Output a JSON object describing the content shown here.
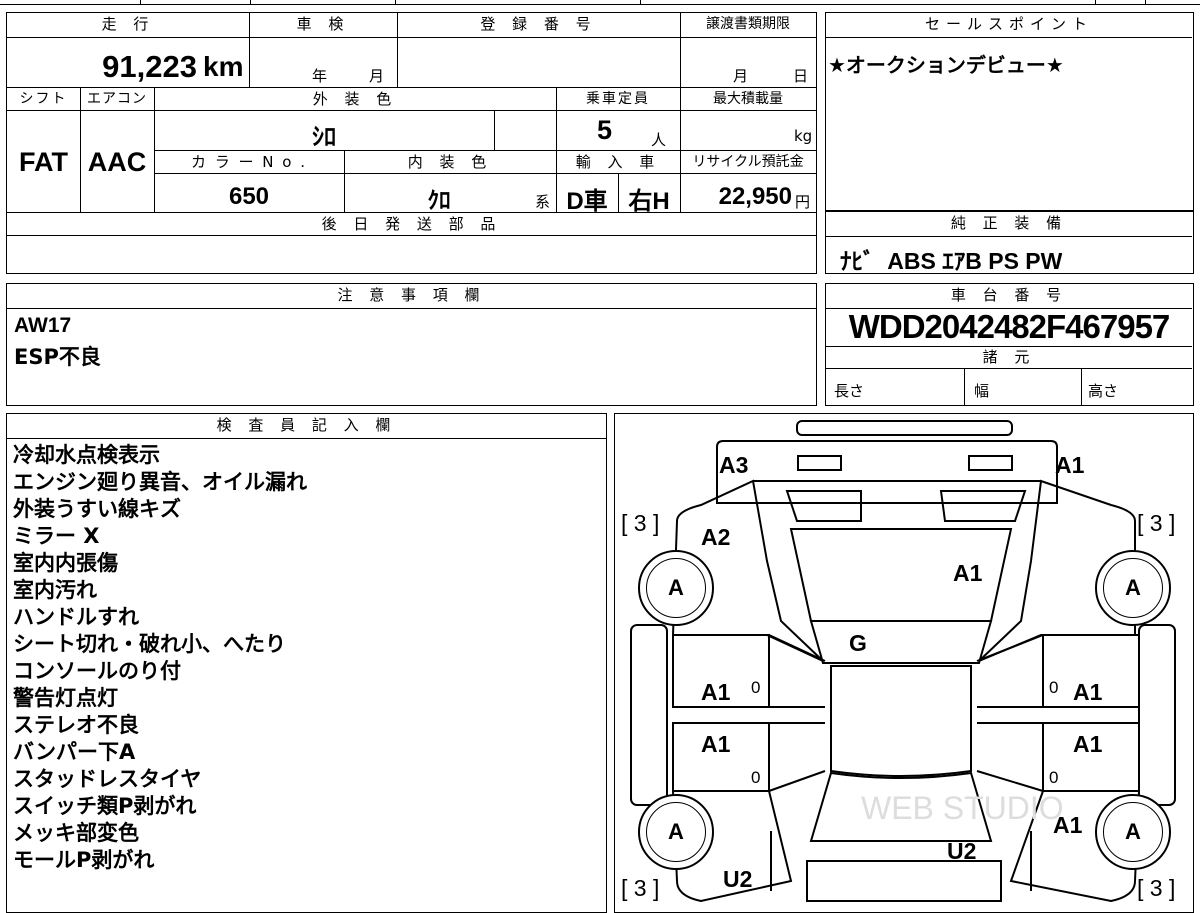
{
  "top_form": {
    "mileage_label": "走 行",
    "mileage": "91,223",
    "mileage_unit": "km",
    "inspection_label": "車 検",
    "year_unit": "年",
    "month_unit": "月",
    "registration_label": "登 録 番 号",
    "transfer_deadline_label": "譲渡書類期限",
    "deadline_month_unit": "月",
    "deadline_day_unit": "日",
    "shift_label": "シフト",
    "shift": "FAT",
    "aircon_label": "エアコン",
    "aircon": "AAC",
    "exterior_color_label": "外 装 色",
    "exterior_color": "ｼﾛ",
    "capacity_label": "乗車定員",
    "capacity": "5",
    "capacity_unit": "人",
    "max_load_label": "最大積載量",
    "max_load_unit": "kg",
    "color_no_label": "カ ラ ー N o .",
    "color_no": "650",
    "interior_color_label": "内 装 色",
    "interior_color": "ｸﾛ",
    "interior_color_suffix": "系",
    "import_label": "輸 入 車",
    "import_type": "D車",
    "steering": "右H",
    "recycle_label": "リサイクル預託金",
    "recycle_fee": "22,950",
    "recycle_unit": "円",
    "later_parts_label": "後 日 発 送 部 品"
  },
  "sales_points": {
    "label": "セールスポイント",
    "text": "★オークションデビュー★"
  },
  "genuine_equipment": {
    "label": "純 正 装 備",
    "text": "ﾅﾋﾞ  ABS ｴｱB PS PW"
  },
  "notes": {
    "label": "注 意 事 項 欄",
    "lines": [
      "AW17",
      "ESP不良"
    ]
  },
  "chassis": {
    "label": "車 台 番 号",
    "number": "WDD2042482F467957",
    "specs_label": "諸 元",
    "length_label": "長さ",
    "width_label": "幅",
    "height_label": "高さ"
  },
  "inspector": {
    "label": "検 査 員 記 入 欄",
    "lines": [
      "冷却水点検表示",
      "エンジン廻り異音、オイル漏れ",
      "外装うすい線キズ",
      "ミラー X",
      "室内内張傷",
      "室内汚れ",
      "ハンドルすれ",
      "シート切れ・破れ小、へたり",
      "コンソールのり付",
      "警告灯点灯",
      "ステレオ不良",
      "バンパー下A",
      "スタッドレスタイヤ",
      "スイッチ類P剥がれ",
      "メッキ部変色",
      "モールP剥がれ"
    ]
  },
  "diagram": {
    "front_left_corner": "A3",
    "front_right_corner": "A1",
    "hood_left": "A2",
    "hood": "A1",
    "windshield": "G",
    "front_left_door": "A1",
    "front_right_door": "A1",
    "rear_left_door": "A1",
    "rear_right_door": "A1",
    "rear_right_fender": "A1",
    "roof_rear": "U2",
    "rear_left": "U2",
    "tread_fl": "[ 3 ]",
    "tread_fr": "[ 3 ]",
    "tread_rl": "[ 3 ]",
    "tread_rr": "[ 3 ]",
    "tire_fl": "A",
    "tire_fr": "A",
    "tire_rl": "A",
    "tire_rr": "A",
    "zero_mark": "0",
    "watermark": "WEB STUDIO"
  }
}
